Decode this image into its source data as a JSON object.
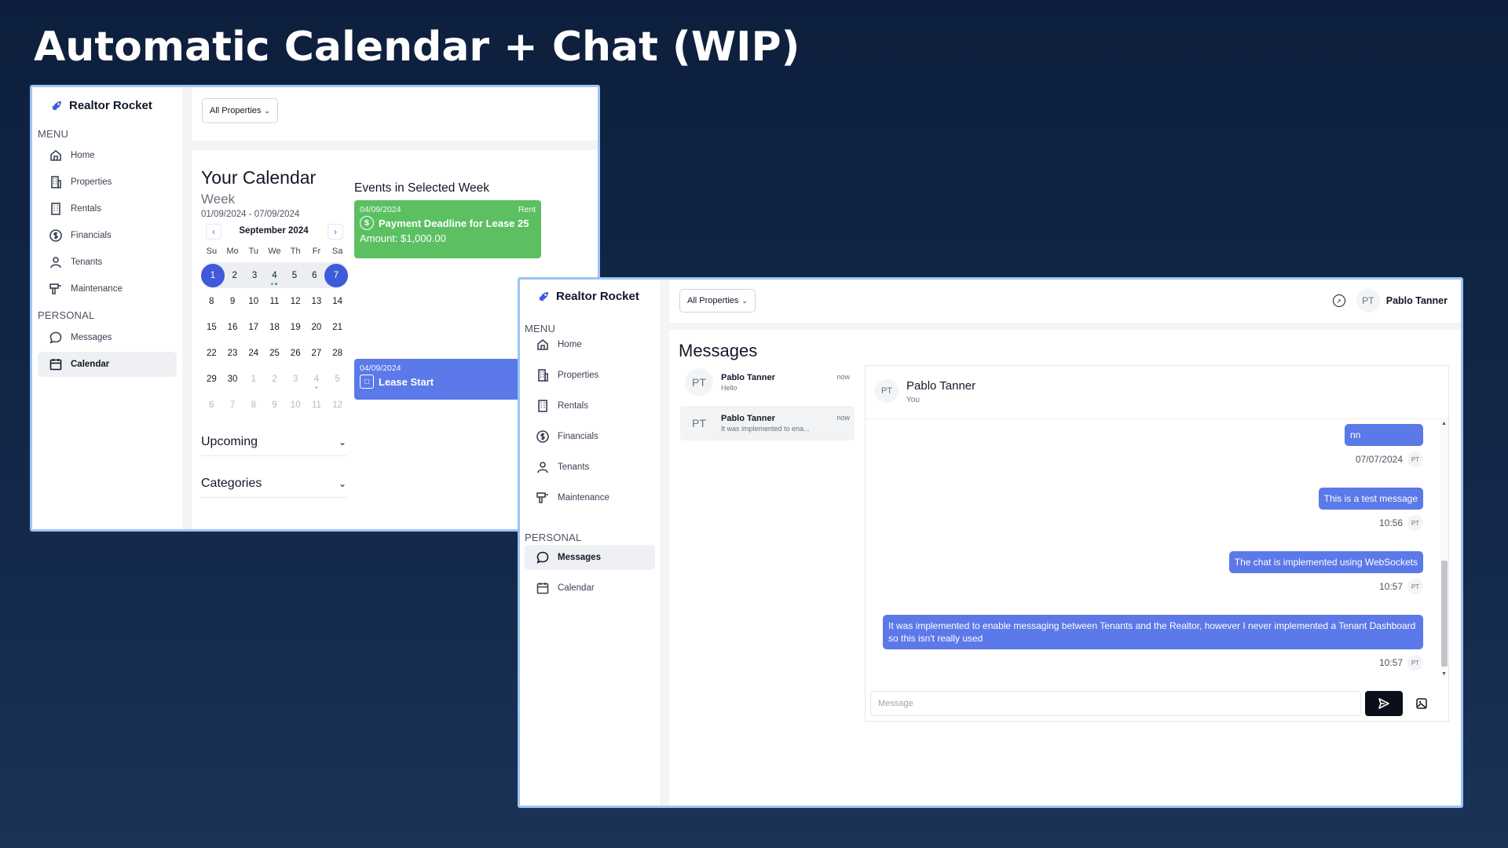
{
  "slide": {
    "title": "Automatic Calendar + Chat (WIP)"
  },
  "brand": {
    "name": "Realtor Rocket"
  },
  "nav": {
    "menu_label": "MENU",
    "personal_label": "PERSONAL",
    "items": [
      {
        "label": "Home",
        "icon": "home-icon"
      },
      {
        "label": "Properties",
        "icon": "building-icon"
      },
      {
        "label": "Rentals",
        "icon": "office-icon"
      },
      {
        "label": "Financials",
        "icon": "dollar-icon"
      },
      {
        "label": "Tenants",
        "icon": "user-icon"
      },
      {
        "label": "Maintenance",
        "icon": "drill-icon"
      }
    ],
    "personal_items": [
      {
        "label": "Messages",
        "icon": "chat-icon"
      },
      {
        "label": "Calendar",
        "icon": "calendar-icon"
      }
    ]
  },
  "filter": {
    "label": "All Properties"
  },
  "calendar": {
    "title": "Your Calendar",
    "view": "Week",
    "range": "01/09/2024 - 07/09/2024",
    "month": "September 2024",
    "weekdays": [
      "Su",
      "Mo",
      "Tu",
      "We",
      "Th",
      "Fr",
      "Sa"
    ],
    "weeks": [
      [
        "1",
        "2",
        "3",
        "4",
        "5",
        "6",
        "7"
      ],
      [
        "8",
        "9",
        "10",
        "11",
        "12",
        "13",
        "14"
      ],
      [
        "15",
        "16",
        "17",
        "18",
        "19",
        "20",
        "21"
      ],
      [
        "22",
        "23",
        "24",
        "25",
        "26",
        "27",
        "28"
      ],
      [
        "29",
        "30",
        "1",
        "2",
        "3",
        "4",
        "5"
      ],
      [
        "6",
        "7",
        "8",
        "9",
        "10",
        "11",
        "12"
      ]
    ],
    "upcoming_label": "Upcoming",
    "categories_label": "Categories"
  },
  "events": {
    "title": "Events in Selected Week",
    "items": [
      {
        "date": "04/09/2024",
        "tag": "Rent",
        "name": "Payment Deadline for Lease 25",
        "amount": "Amount: $1,000.00",
        "color": "#5cc063"
      },
      {
        "date": "04/09/2024",
        "tag": "",
        "name": "Lease Start",
        "color": "#5b79e8"
      }
    ]
  },
  "user": {
    "initials": "PT",
    "name": "Pablo Tanner"
  },
  "messages": {
    "title": "Messages",
    "conversations": [
      {
        "name": "Pablo Tanner",
        "preview": "Hello",
        "time": "now"
      },
      {
        "name": "Pablo Tanner",
        "preview": "It was implemented to ena...",
        "time": "now"
      }
    ],
    "chat": {
      "name": "Pablo Tanner",
      "subtitle": "You",
      "messages": [
        {
          "text": "nn",
          "time": "07/07/2024"
        },
        {
          "text": "This is a test message",
          "time": "10:56"
        },
        {
          "text": "The chat is implemented using WebSockets",
          "time": "10:57"
        },
        {
          "text": "It was implemented to enable messaging between Tenants and the Realtor, however I never implemented a Tenant Dashboard so this isn't really used",
          "time": "10:57"
        }
      ],
      "input_placeholder": "Message"
    }
  },
  "colors": {
    "accent": "#3f5bd9",
    "bubble": "#5b79e8",
    "event_green": "#5cc063",
    "window_border": "#9cc4f2"
  }
}
